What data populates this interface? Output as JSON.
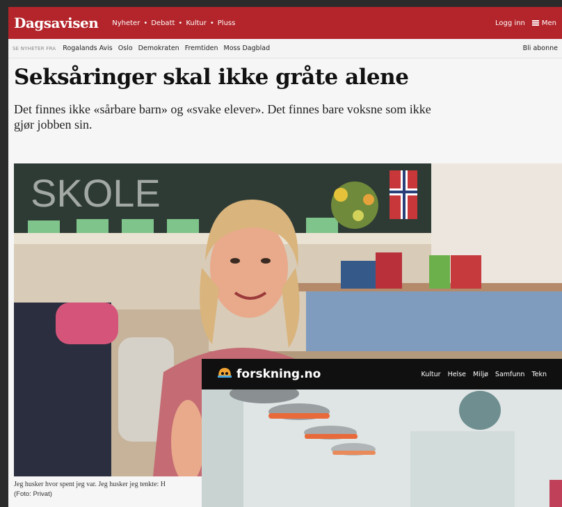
{
  "dagsavisen": {
    "logo": "Dagsavisen",
    "nav": [
      "Nyheter",
      "Debatt",
      "Kultur",
      "Pluss"
    ],
    "nav_separator": "•",
    "login": "Logg inn",
    "menu": "Men",
    "brand_color": "#b3252b",
    "subbar": {
      "label": "SE NYHETER FRA",
      "links": [
        "Rogalands Avis",
        "Oslo",
        "Demokraten",
        "Fremtiden",
        "Moss Dagblad"
      ],
      "subscribe": "Bli abonne"
    },
    "article": {
      "headline": "Seksåringer skal ikke gråte alene",
      "lead": "Det finnes ikke «sårbare barn» og «svake elever». Det finnes bare voksne som ikke gjør jobben sin.",
      "photo_text": "SKOLE",
      "caption": "Jeg husker hvor spent jeg var. Jeg husker jeg tenkte: H",
      "credit": "(Foto: Privat)"
    }
  },
  "forskning": {
    "logo": "forskning.no",
    "nav": [
      "Kultur",
      "Helse",
      "Miljø",
      "Samfunn",
      "Tekn"
    ]
  }
}
